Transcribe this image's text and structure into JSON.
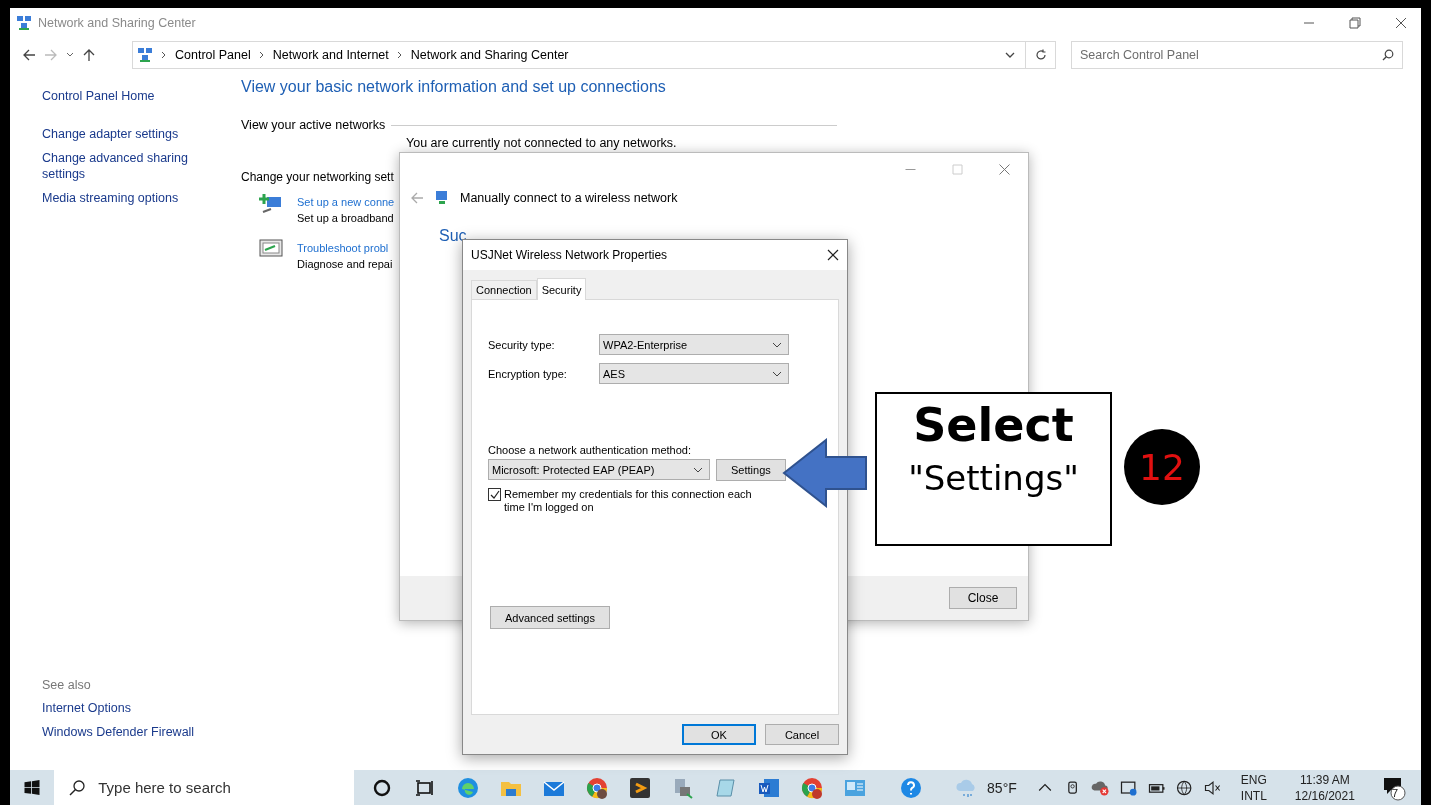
{
  "window": {
    "title": "Network and Sharing Center"
  },
  "address_bar": {
    "breadcrumbs": [
      "Control Panel",
      "Network and Internet",
      "Network and Sharing Center"
    ]
  },
  "search": {
    "placeholder": "Search Control Panel"
  },
  "sidebar": {
    "items": [
      "Control Panel Home",
      "Change adapter settings",
      "Change advanced sharing settings",
      "Media streaming options"
    ],
    "see_also_heading": "See also",
    "see_also": [
      "Internet Options",
      "Windows Defender Firewall"
    ]
  },
  "main": {
    "heading": "View your basic network information and set up connections",
    "active_networks_label": "View your active networks",
    "not_connected": "You are currently not connected to any networks.",
    "change_label": "Change your networking sett",
    "tasks": [
      {
        "link": "Set up a new conne",
        "description": "Set up a broadband"
      },
      {
        "link": "Troubleshoot probl",
        "description": "Diagnose and repai"
      }
    ]
  },
  "wizard": {
    "title": "Manually connect to a wireless network",
    "heading": "Suc",
    "button": "Close"
  },
  "dialog": {
    "title": "USJNet Wireless Network Properties",
    "tabs": [
      {
        "label": "Connection",
        "selected": false
      },
      {
        "label": "Security",
        "selected": true
      }
    ],
    "fields": [
      {
        "label": "Security type:",
        "value": "WPA2-Enterprise"
      },
      {
        "label": "Encryption type:",
        "value": "AES"
      }
    ],
    "auth_label": "Choose a network authentication method:",
    "auth_method": "Microsoft: Protected EAP (PEAP)",
    "settings_button": "Settings",
    "remember": {
      "label": "Remember my credentials for this connection each time I'm logged on",
      "checked": true
    },
    "advanced_button": "Advanced settings",
    "buttons": [
      {
        "label": "OK",
        "default": true
      },
      {
        "label": "Cancel",
        "default": false
      }
    ]
  },
  "callout": {
    "title": "Select",
    "text": "\"Settings\"",
    "step": "12"
  },
  "taskbar": {
    "search_placeholder": "Type here to search",
    "weather": "85°F",
    "language": [
      "ENG",
      "INTL"
    ],
    "time": "11:39 AM",
    "date": "12/16/2021",
    "notifications": "7"
  }
}
